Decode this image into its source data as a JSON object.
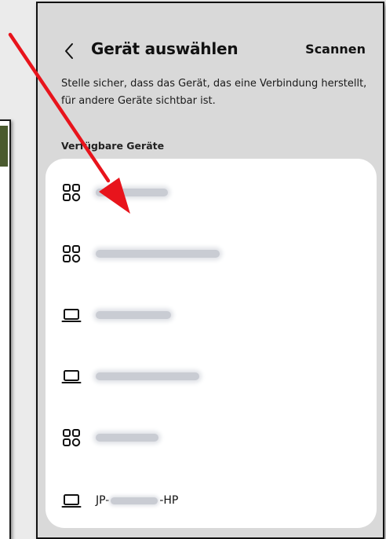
{
  "header": {
    "back_icon": "chevron-left-icon",
    "title": "Gerät auswählen",
    "scan_label": "Scannen"
  },
  "description": "Stelle sicher, dass das Gerät, das eine Verbindung herstellt, für andere Geräte sichtbar ist.",
  "section_label": "Verfügbare Geräte",
  "devices": [
    {
      "icon": "devices-grid-icon"
    },
    {
      "icon": "devices-grid-icon"
    },
    {
      "icon": "laptop-icon"
    },
    {
      "icon": "laptop-icon"
    },
    {
      "icon": "devices-grid-icon"
    },
    {
      "icon": "laptop-icon",
      "name_prefix": "JP-",
      "name_suffix": "-HP"
    }
  ],
  "colors": {
    "background": "#d9d9d9",
    "card": "#ffffff",
    "arrow": "#e8141c",
    "text": "#111111"
  }
}
